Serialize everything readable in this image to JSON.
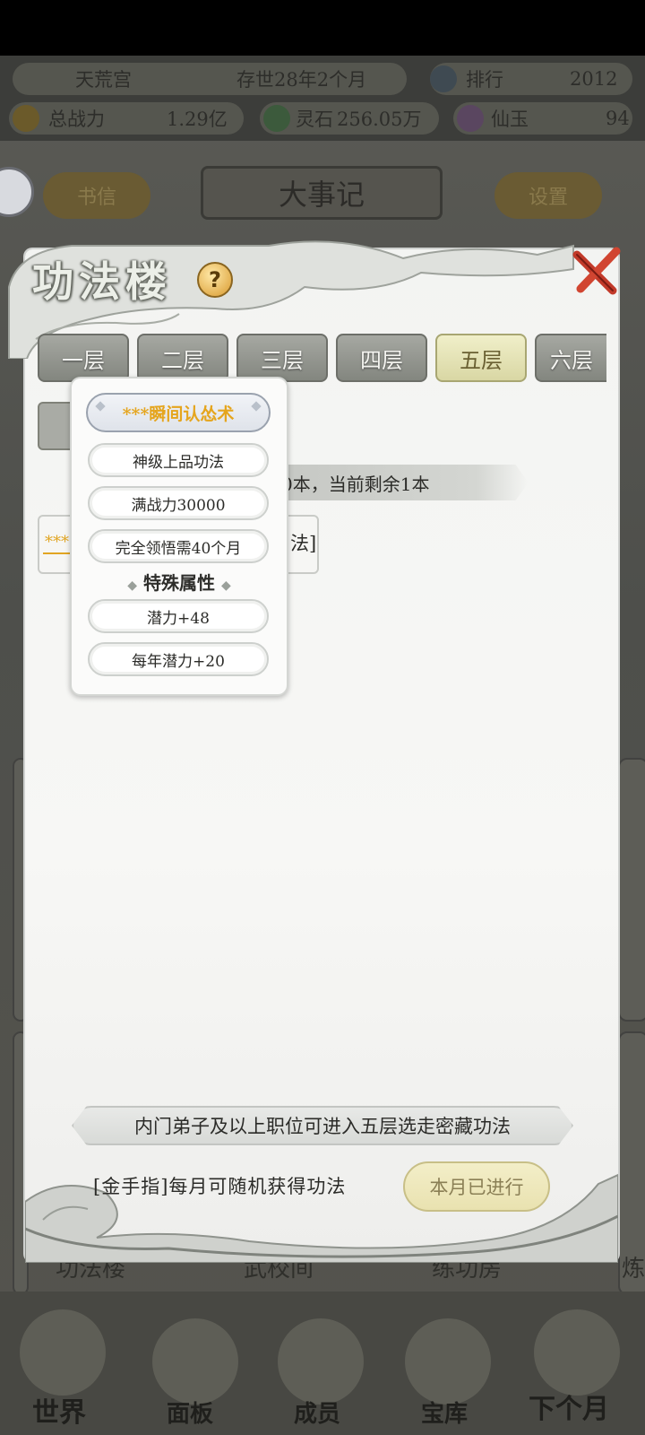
{
  "top": {
    "sect_name": "天荒宫",
    "existence": "存世28年2个月",
    "rank_label": "排行",
    "rank_value": "2012",
    "power_label": "总战力",
    "power_value": "1.29亿",
    "stone_label": "灵石",
    "stone_value": "256.05万",
    "jade_label": "仙玉",
    "jade_value": "94"
  },
  "nav": {
    "letters": "书信",
    "title": "大事记",
    "settings": "设置"
  },
  "background_cards": {
    "left": "功法楼",
    "mid": "武校间",
    "right": "练功房",
    "edge": "炼"
  },
  "bottom_nav": [
    "世界",
    "面板",
    "成员",
    "宝库",
    "下个月"
  ],
  "dialog": {
    "title": "功法楼",
    "help": "?",
    "tabs": [
      "一层",
      "二层",
      "三层",
      "四层",
      "五层",
      "六层"
    ],
    "active_tab": "五层",
    "info_strip": "0本，当前剩余1本",
    "book_stars": "***",
    "book_suffix": "法]",
    "rule": "内门弟子及以上职位可进入五层选走密藏功法",
    "goldfinger": "[金手指]每月可随机获得功法",
    "month_button": "本月已进行"
  },
  "popup": {
    "name": "***瞬间认怂术",
    "grade": "神级上品功法",
    "full_power": "满战力30000",
    "comprehend": "完全领悟需40个月",
    "section": "特殊属性",
    "attr1": "潜力+48",
    "attr2": "每年潜力+20"
  },
  "colors": {
    "accent_gold": "#e5a51d",
    "active_tab": "#d9d7a4"
  }
}
